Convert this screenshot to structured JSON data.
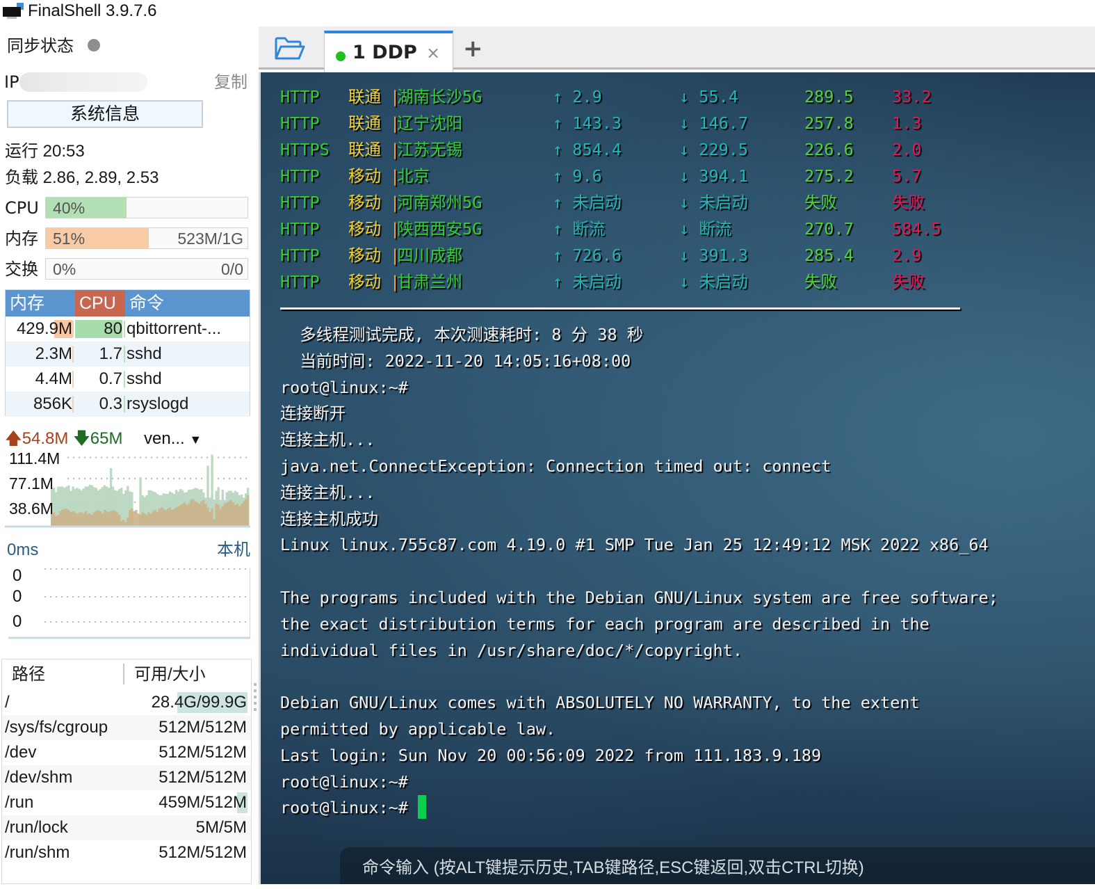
{
  "app": {
    "title": "FinalShell 3.9.7.6"
  },
  "sidebar": {
    "sync_label": "同步状态",
    "ip_label": "IP",
    "copy_label": "复制",
    "sysinfo_button": "系统信息",
    "uptime": "运行 20:53",
    "load": "负载 2.86, 2.89, 2.53",
    "cpu": {
      "label": "CPU",
      "percent_text": "40%",
      "percent": 40,
      "color": "#b2e0b4"
    },
    "memory": {
      "label": "内存",
      "percent_text": "51%",
      "percent": 51,
      "detail": "523M/1G",
      "color": "#f8cba6"
    },
    "swap": {
      "label": "交换",
      "percent_text": "0%",
      "percent": 0,
      "detail": "0/0"
    },
    "process_table": {
      "headers": {
        "mem": "内存",
        "cpu": "CPU",
        "cmd": "命令"
      },
      "header_colors": {
        "default": "#5b95d0",
        "cpu": "#c96650"
      },
      "rows": [
        {
          "mem": "429.9M",
          "cpu": "80",
          "cmd": "qbittorrent-...",
          "mem_fraction": 0.82,
          "cpu_fraction": 1.0
        },
        {
          "mem": "2.3M",
          "cpu": "1.7",
          "cmd": "sshd",
          "mem_fraction": 0.0,
          "cpu_fraction": 0.0
        },
        {
          "mem": "4.4M",
          "cpu": "0.7",
          "cmd": "sshd",
          "mem_fraction": 0.0,
          "cpu_fraction": 0.0
        },
        {
          "mem": "856K",
          "cpu": "0.3",
          "cmd": "rsyslogd",
          "mem_fraction": 0.0,
          "cpu_fraction": 0.0
        }
      ]
    },
    "network": {
      "up": "54.8M",
      "down": "65M",
      "interface": "ven...",
      "axis_labels": [
        "111.4M",
        "77.1M",
        "38.6M"
      ],
      "axis_values": [
        111.4,
        77.1,
        38.6
      ],
      "max": 120,
      "down_series": [
        0,
        0,
        0,
        0,
        0,
        0,
        0,
        0,
        0,
        0,
        0,
        0,
        0,
        0,
        0,
        0,
        0,
        0,
        0,
        0,
        0,
        0,
        0,
        0,
        0,
        0,
        0,
        0,
        0,
        0,
        0,
        0,
        0,
        0,
        0,
        0,
        0,
        0,
        0,
        0,
        0,
        0,
        0,
        0,
        0,
        0,
        0,
        0,
        0,
        0,
        0,
        0,
        0,
        0,
        0,
        0,
        0,
        0,
        0,
        0,
        0,
        0,
        0,
        0,
        0,
        0,
        0,
        0,
        0,
        0,
        0,
        0,
        0,
        0,
        0,
        0,
        0,
        0,
        0,
        0,
        0,
        0,
        0,
        0,
        0,
        0,
        0,
        0,
        0,
        0,
        0,
        0,
        0,
        0,
        0,
        0,
        0,
        0,
        0,
        0,
        0,
        0,
        0,
        0,
        0,
        0,
        0,
        0,
        0,
        0,
        0,
        0,
        0,
        0,
        0,
        0,
        0,
        0,
        0,
        0
      ],
      "down_values": [
        62,
        62,
        55,
        64,
        64,
        64,
        62,
        64,
        66,
        57,
        64,
        60,
        62,
        60,
        58,
        61,
        64,
        64,
        67,
        66,
        63,
        62,
        58,
        60,
        63,
        66,
        64,
        62,
        94,
        64,
        58,
        57,
        60,
        62,
        52,
        58,
        65,
        56,
        55,
        0,
        0,
        0,
        79,
        50,
        47,
        50,
        58,
        58,
        56,
        55,
        52,
        50,
        50,
        53,
        52,
        52,
        56,
        54,
        52,
        59,
        56,
        60,
        58,
        54,
        55,
        59,
        59,
        60,
        62,
        61,
        59,
        60,
        54,
        46,
        98,
        46,
        116,
        43,
        57,
        63,
        42,
        59,
        42,
        55,
        57,
        57,
        54,
        57,
        55,
        50,
        51,
        46,
        53,
        62
      ],
      "up_values": [
        20,
        22,
        16,
        18,
        24,
        26,
        28,
        28,
        26,
        22,
        24,
        22,
        20,
        22,
        22,
        20,
        24,
        20,
        20,
        18,
        22,
        24,
        26,
        24,
        20,
        26,
        24,
        22,
        24,
        26,
        24,
        22,
        18,
        8,
        10,
        6,
        14,
        26,
        28,
        24,
        26,
        20,
        18,
        22,
        20,
        18,
        22,
        20,
        24,
        26,
        22,
        28,
        30,
        28,
        26,
        28,
        30,
        26,
        28,
        30,
        32,
        34,
        36,
        38,
        34,
        36,
        42,
        44,
        40,
        38,
        36,
        40,
        42,
        36,
        30,
        22,
        28,
        10,
        36,
        34,
        28,
        32,
        36,
        38,
        40,
        42,
        38,
        34,
        36,
        32,
        36,
        40,
        44,
        50
      ]
    },
    "ping": {
      "latency": "0ms",
      "target": "本机",
      "axis_labels": [
        "0",
        "0",
        "0"
      ]
    },
    "disk_table": {
      "headers": {
        "path": "路径",
        "size": "可用/大小"
      },
      "rows": [
        {
          "path": "/",
          "size": "28.4G/99.9G",
          "used_fraction": 0.72
        },
        {
          "path": "/sys/fs/cgroup",
          "size": "512M/512M",
          "used_fraction": 0.0
        },
        {
          "path": "/dev",
          "size": "512M/512M",
          "used_fraction": 0.0
        },
        {
          "path": "/dev/shm",
          "size": "512M/512M",
          "used_fraction": 0.0
        },
        {
          "path": "/run",
          "size": "459M/512M",
          "used_fraction": 0.11
        },
        {
          "path": "/run/lock",
          "size": "5M/5M",
          "used_fraction": 0.0
        },
        {
          "path": "/run/shm",
          "size": "512M/512M",
          "used_fraction": 0.0
        }
      ]
    }
  },
  "tabs": {
    "items": [
      {
        "label": "1 DDP",
        "connected": true,
        "status_color": "#1ec21e"
      }
    ],
    "close_symbol": "×",
    "add_symbol": "+"
  },
  "terminal": {
    "speed_rows": [
      {
        "proto": "HTTP",
        "isp": "联通",
        "city": "湖南长沙5G",
        "up": "↑ 2.9",
        "down": "↓ 55.4",
        "latency": "289.5",
        "jitter": "33.2"
      },
      {
        "proto": "HTTP",
        "isp": "联通",
        "city": "辽宁沈阳",
        "up": "↑ 143.3",
        "down": "↓ 146.7",
        "latency": "257.8",
        "jitter": "1.3"
      },
      {
        "proto": "HTTPS",
        "isp": "联通",
        "city": "江苏无锡",
        "up": "↑ 854.4",
        "down": "↓ 229.5",
        "latency": "226.6",
        "jitter": "2.0"
      },
      {
        "proto": "HTTP",
        "isp": "移动",
        "city": "北京",
        "up": "↑ 9.6",
        "down": "↓ 394.1",
        "latency": "275.2",
        "jitter": "5.7"
      },
      {
        "proto": "HTTP",
        "isp": "移动",
        "city": "河南郑州5G",
        "up": "↑ 未启动",
        "down": "↓ 未启动",
        "latency": "失败",
        "jitter": "失败"
      },
      {
        "proto": "HTTP",
        "isp": "移动",
        "city": "陕西西安5G",
        "up": "↑ 断流",
        "down": "↓ 断流",
        "latency": "270.7",
        "jitter": "584.5"
      },
      {
        "proto": "HTTP",
        "isp": "移动",
        "city": "四川成都",
        "up": "↑ 726.6",
        "down": "↓ 391.3",
        "latency": "285.4",
        "jitter": "2.9"
      },
      {
        "proto": "HTTP",
        "isp": "移动",
        "city": "甘肃兰州",
        "up": "↑ 未启动",
        "down": "↓ 未启动",
        "latency": "失败",
        "jitter": "失败"
      }
    ],
    "separator": "|",
    "lines": [
      "  多线程测试完成, 本次测速耗时: 8 分 38 秒",
      "  当前时间: 2022-11-20 14:05:16+08:00",
      "root@linux:~#",
      "连接断开",
      "连接主机...",
      "java.net.ConnectException: Connection timed out: connect",
      "连接主机...",
      "连接主机成功",
      "Linux linux.755c87.com 4.19.0 #1 SMP Tue Jan 25 12:49:12 MSK 2022 x86_64",
      "",
      "The programs included with the Debian GNU/Linux system are free software;",
      "the exact distribution terms for each program are described in the",
      "individual files in /usr/share/doc/*/copyright.",
      "",
      "Debian GNU/Linux comes with ABSOLUTELY NO WARRANTY, to the extent",
      "permitted by applicable law.",
      "Last login: Sun Nov 20 00:56:09 2022 from 111.183.9.189",
      "root@linux:~#"
    ],
    "prompt": "root@linux:~#",
    "command_input_placeholder": "命令输入 (按ALT键提示历史,TAB键路径,ESC键返回,双击CTRL切换)"
  },
  "colors": {
    "accent": "#2a86e0",
    "cursor": "#0dcf4e"
  }
}
